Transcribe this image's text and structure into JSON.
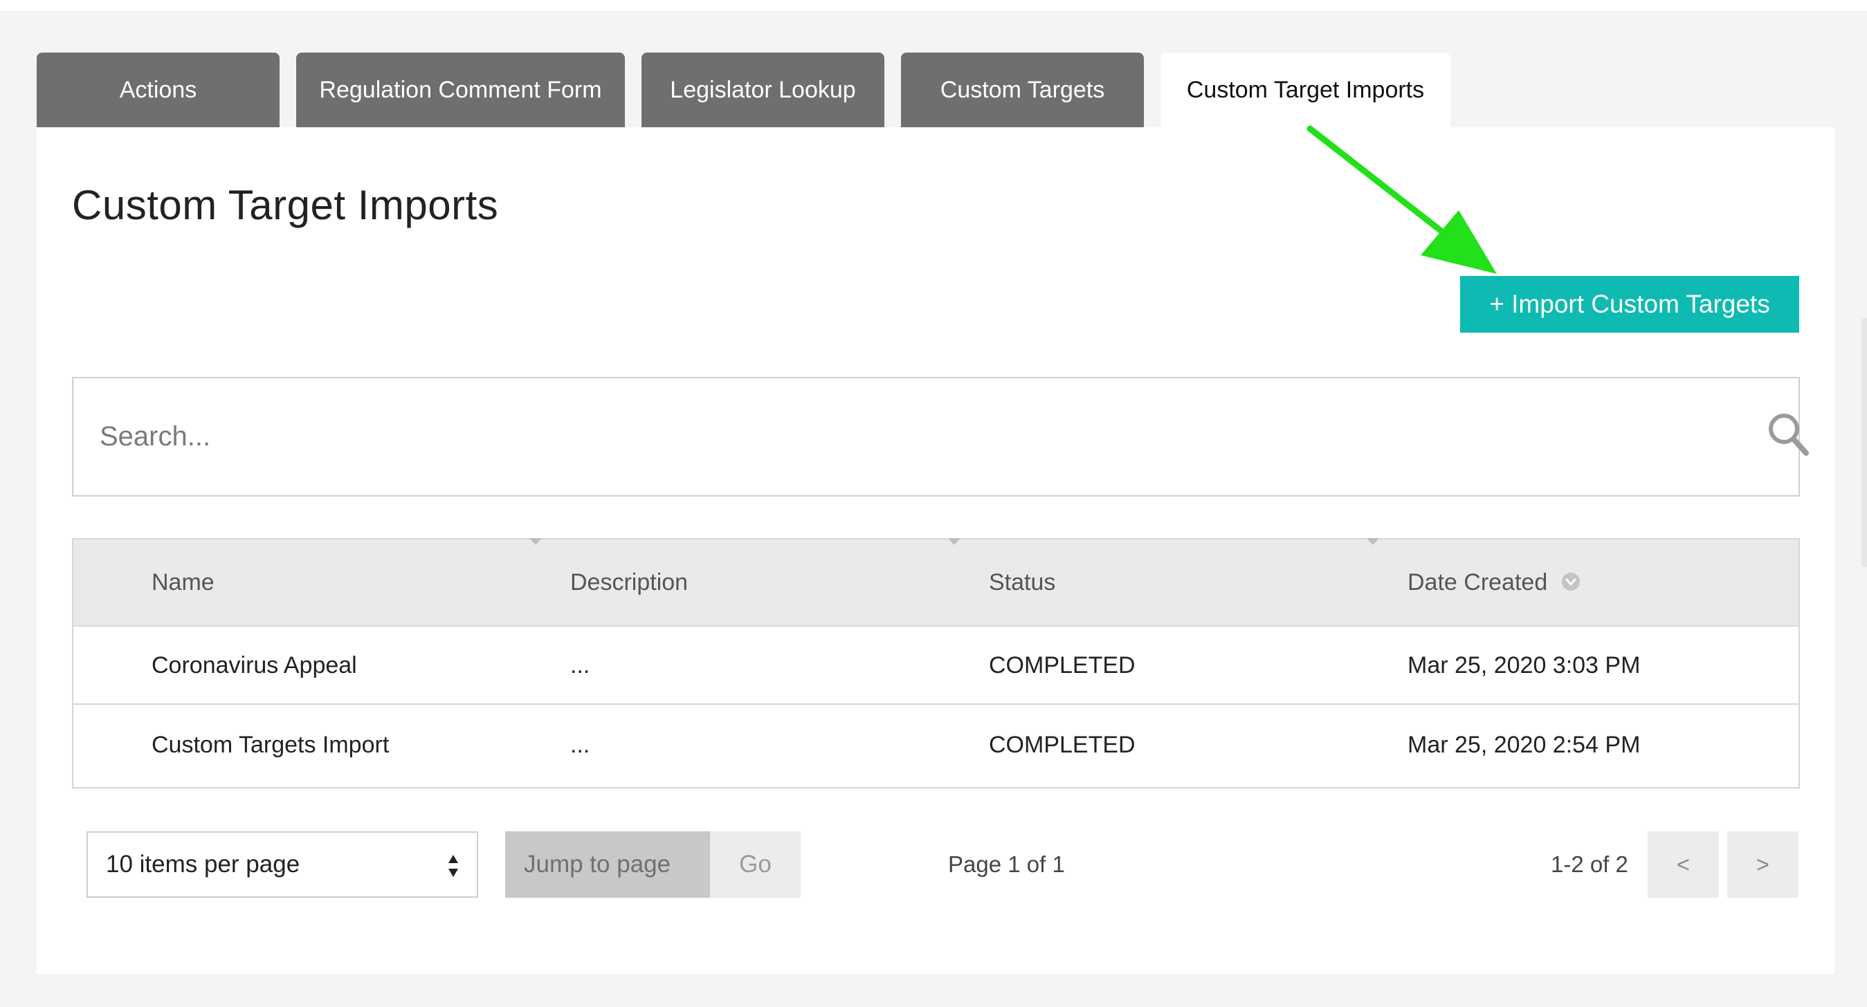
{
  "tabs": [
    {
      "label": "Actions",
      "active": false
    },
    {
      "label": "Regulation Comment Form",
      "active": false
    },
    {
      "label": "Legislator Lookup",
      "active": false
    },
    {
      "label": "Custom Targets",
      "active": false
    },
    {
      "label": "Custom Target Imports",
      "active": true
    }
  ],
  "page": {
    "title": "Custom Target Imports",
    "import_button": "+ Import Custom Targets"
  },
  "search": {
    "placeholder": "Search...",
    "value": ""
  },
  "table": {
    "headers": [
      "Name",
      "Description",
      "Status",
      "Date Created"
    ],
    "rows": [
      {
        "name": "Coronavirus Appeal",
        "description": "...",
        "status": "COMPLETED",
        "date": "Mar 25, 2020 3:03 PM"
      },
      {
        "name": "Custom Targets Import",
        "description": "...",
        "status": "COMPLETED",
        "date": "Mar 25, 2020 2:54 PM"
      }
    ]
  },
  "pagination": {
    "per_page": "10 items per page",
    "jump_placeholder": "Jump to page",
    "go_label": "Go",
    "page_label": "Page 1 of 1",
    "range_label": "1-2 of 2",
    "prev_label": "<",
    "next_label": ">"
  },
  "colors": {
    "accent": "#0fbab2",
    "tab_inactive": "#6e6f71",
    "annotation_arrow": "#22e01a"
  }
}
